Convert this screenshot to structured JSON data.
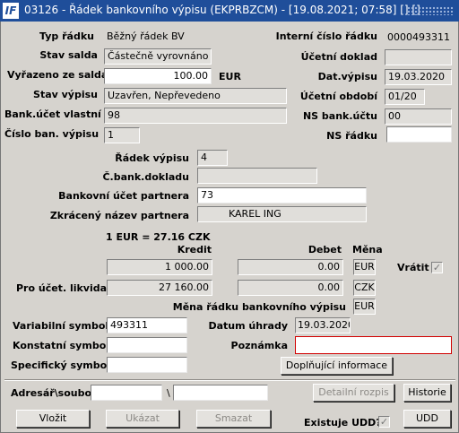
{
  "window": {
    "logo": "IF",
    "title": "03126 - Řádek bankovního výpisu (EKPRBZCM) - [19.08.2021; 07:58]  [] []"
  },
  "labels": {
    "typ_radku": "Typ řádku",
    "stav_salda": "Stav salda",
    "vyrazeno": "Vyřazeno ze salda",
    "stav_vypisu": "Stav výpisu",
    "bank_ucet_vlastni": "Bank.účet vlastní",
    "cislo_ban_vypisu": "Číslo ban. výpisu",
    "interni_cislo": "Interní číslo řádku",
    "ucetni_doklad": "Účetní doklad",
    "dat_vypisu": "Dat.výpisu",
    "ucetni_obdobi": "Účetní období",
    "ns_bank_uctu": "NS bank.účtu",
    "ns_radku": "NS řádku",
    "radek_vypisu": "Řádek výpisu",
    "c_bank_dokladu": "Č.bank.dokladu",
    "bankovni_ucet_partnera": "Bankovní účet partnera",
    "zkraceny_nazev": "Zkrácený název partnera",
    "kurz": "1 EUR = 27.16 CZK",
    "kredit": "Kredit",
    "debet": "Debet",
    "mena": "Měna",
    "vratit": "Vrátit",
    "pro_ucet": "Pro účet. likvidaci",
    "mena_radku": "Měna řádku bankovního výpisu",
    "variabilni": "Variabilní symbol",
    "konstatni": "Konstatní symbol",
    "specificky": "Specifický symbol",
    "datum_uhrady": "Datum úhrady",
    "poznamka": "Poznámka",
    "adresar": "Adresář\\soubor",
    "backslash": "\\",
    "existuje_udd": "Existuje UDD?"
  },
  "values": {
    "typ_radku": "Běžný řádek BV",
    "stav_salda": "Částečně vyrovnáno",
    "vyrazeno": "100.00",
    "vyrazeno_mena": "EUR",
    "stav_vypisu": "Uzavřen, Nepřevedeno",
    "bank_ucet_vlastni": "98",
    "cislo_ban_vypisu": "1",
    "interni_cislo": "0000493311",
    "ucetni_doklad": "",
    "dat_vypisu": "19.03.2020",
    "ucetni_obdobi": "01/20",
    "ns_bank_uctu": "00",
    "ns_radku": "",
    "radek_vypisu": "4",
    "c_bank_dokladu": "",
    "bankovni_ucet_partnera": "73",
    "zkraceny_nazev": "KAREL ING",
    "kredit_1": "1 000.00",
    "debet_1": "0.00",
    "mena_1": "EUR",
    "kredit_2": "27 160.00",
    "debet_2": "0.00",
    "mena_2": "CZK",
    "mena_radku": "EUR",
    "variabilni": "493311",
    "konstatni": "",
    "specificky": "",
    "datum_uhrady": "19.03.2020",
    "poznamka": "",
    "adresar_1": "",
    "adresar_2": "",
    "vratit_checked": true,
    "existuje_udd_checked": true
  },
  "buttons": {
    "doplnujici": "Doplňující informace",
    "detailni_rozpis": "Detailní rozpis",
    "historie": "Historie",
    "vlozit": "Vložit",
    "ukazat": "Ukázat",
    "smazat": "Smazat",
    "udd": "UDD"
  },
  "icons": {
    "check": "✓"
  },
  "colors": {
    "title_bar": "#1f4e9a",
    "error_border": "#d10000",
    "window_bg": "#d6d3ce"
  }
}
